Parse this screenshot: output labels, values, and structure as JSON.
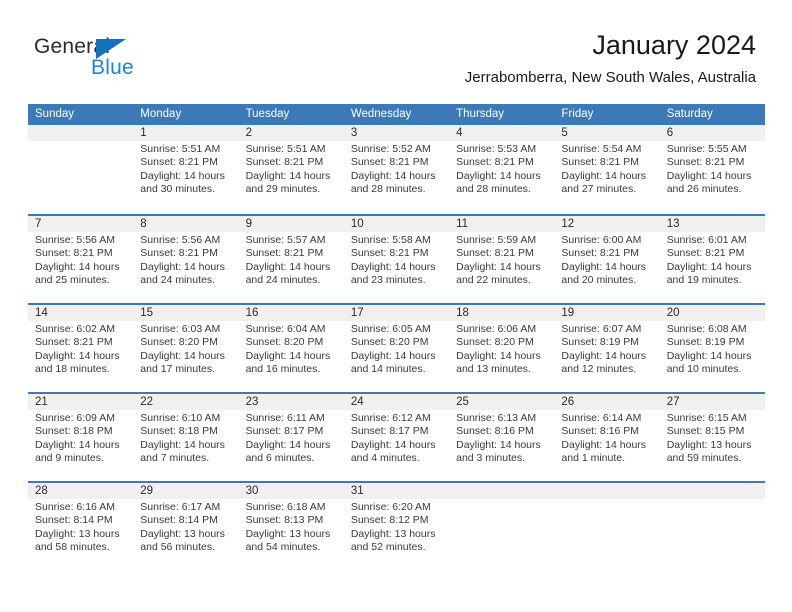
{
  "brand": {
    "name_part1": "General",
    "name_part2": "Blue",
    "color_dark": "#2b2b2b",
    "color_blue": "#1e84d6",
    "triangle_color": "#1271c0"
  },
  "header": {
    "title": "January 2024",
    "subtitle": "Jerrabomberra, New South Wales, Australia"
  },
  "theme": {
    "header_blue": "#3b79b8",
    "number_band_gray": "#f0f0f0",
    "text_color": "#3a3a3a"
  },
  "weekday_headers": [
    "Sunday",
    "Monday",
    "Tuesday",
    "Wednesday",
    "Thursday",
    "Friday",
    "Saturday"
  ],
  "weeks": [
    {
      "days": [
        {
          "number": "",
          "sunrise": "",
          "sunset": "",
          "daylight_line1": "",
          "daylight_line2": ""
        },
        {
          "number": "1",
          "sunrise": "Sunrise: 5:51 AM",
          "sunset": "Sunset: 8:21 PM",
          "daylight_line1": "Daylight: 14 hours",
          "daylight_line2": "and 30 minutes."
        },
        {
          "number": "2",
          "sunrise": "Sunrise: 5:51 AM",
          "sunset": "Sunset: 8:21 PM",
          "daylight_line1": "Daylight: 14 hours",
          "daylight_line2": "and 29 minutes."
        },
        {
          "number": "3",
          "sunrise": "Sunrise: 5:52 AM",
          "sunset": "Sunset: 8:21 PM",
          "daylight_line1": "Daylight: 14 hours",
          "daylight_line2": "and 28 minutes."
        },
        {
          "number": "4",
          "sunrise": "Sunrise: 5:53 AM",
          "sunset": "Sunset: 8:21 PM",
          "daylight_line1": "Daylight: 14 hours",
          "daylight_line2": "and 28 minutes."
        },
        {
          "number": "5",
          "sunrise": "Sunrise: 5:54 AM",
          "sunset": "Sunset: 8:21 PM",
          "daylight_line1": "Daylight: 14 hours",
          "daylight_line2": "and 27 minutes."
        },
        {
          "number": "6",
          "sunrise": "Sunrise: 5:55 AM",
          "sunset": "Sunset: 8:21 PM",
          "daylight_line1": "Daylight: 14 hours",
          "daylight_line2": "and 26 minutes."
        }
      ]
    },
    {
      "days": [
        {
          "number": "7",
          "sunrise": "Sunrise: 5:56 AM",
          "sunset": "Sunset: 8:21 PM",
          "daylight_line1": "Daylight: 14 hours",
          "daylight_line2": "and 25 minutes."
        },
        {
          "number": "8",
          "sunrise": "Sunrise: 5:56 AM",
          "sunset": "Sunset: 8:21 PM",
          "daylight_line1": "Daylight: 14 hours",
          "daylight_line2": "and 24 minutes."
        },
        {
          "number": "9",
          "sunrise": "Sunrise: 5:57 AM",
          "sunset": "Sunset: 8:21 PM",
          "daylight_line1": "Daylight: 14 hours",
          "daylight_line2": "and 24 minutes."
        },
        {
          "number": "10",
          "sunrise": "Sunrise: 5:58 AM",
          "sunset": "Sunset: 8:21 PM",
          "daylight_line1": "Daylight: 14 hours",
          "daylight_line2": "and 23 minutes."
        },
        {
          "number": "11",
          "sunrise": "Sunrise: 5:59 AM",
          "sunset": "Sunset: 8:21 PM",
          "daylight_line1": "Daylight: 14 hours",
          "daylight_line2": "and 22 minutes."
        },
        {
          "number": "12",
          "sunrise": "Sunrise: 6:00 AM",
          "sunset": "Sunset: 8:21 PM",
          "daylight_line1": "Daylight: 14 hours",
          "daylight_line2": "and 20 minutes."
        },
        {
          "number": "13",
          "sunrise": "Sunrise: 6:01 AM",
          "sunset": "Sunset: 8:21 PM",
          "daylight_line1": "Daylight: 14 hours",
          "daylight_line2": "and 19 minutes."
        }
      ]
    },
    {
      "days": [
        {
          "number": "14",
          "sunrise": "Sunrise: 6:02 AM",
          "sunset": "Sunset: 8:21 PM",
          "daylight_line1": "Daylight: 14 hours",
          "daylight_line2": "and 18 minutes."
        },
        {
          "number": "15",
          "sunrise": "Sunrise: 6:03 AM",
          "sunset": "Sunset: 8:20 PM",
          "daylight_line1": "Daylight: 14 hours",
          "daylight_line2": "and 17 minutes."
        },
        {
          "number": "16",
          "sunrise": "Sunrise: 6:04 AM",
          "sunset": "Sunset: 8:20 PM",
          "daylight_line1": "Daylight: 14 hours",
          "daylight_line2": "and 16 minutes."
        },
        {
          "number": "17",
          "sunrise": "Sunrise: 6:05 AM",
          "sunset": "Sunset: 8:20 PM",
          "daylight_line1": "Daylight: 14 hours",
          "daylight_line2": "and 14 minutes."
        },
        {
          "number": "18",
          "sunrise": "Sunrise: 6:06 AM",
          "sunset": "Sunset: 8:20 PM",
          "daylight_line1": "Daylight: 14 hours",
          "daylight_line2": "and 13 minutes."
        },
        {
          "number": "19",
          "sunrise": "Sunrise: 6:07 AM",
          "sunset": "Sunset: 8:19 PM",
          "daylight_line1": "Daylight: 14 hours",
          "daylight_line2": "and 12 minutes."
        },
        {
          "number": "20",
          "sunrise": "Sunrise: 6:08 AM",
          "sunset": "Sunset: 8:19 PM",
          "daylight_line1": "Daylight: 14 hours",
          "daylight_line2": "and 10 minutes."
        }
      ]
    },
    {
      "days": [
        {
          "number": "21",
          "sunrise": "Sunrise: 6:09 AM",
          "sunset": "Sunset: 8:18 PM",
          "daylight_line1": "Daylight: 14 hours",
          "daylight_line2": "and 9 minutes."
        },
        {
          "number": "22",
          "sunrise": "Sunrise: 6:10 AM",
          "sunset": "Sunset: 8:18 PM",
          "daylight_line1": "Daylight: 14 hours",
          "daylight_line2": "and 7 minutes."
        },
        {
          "number": "23",
          "sunrise": "Sunrise: 6:11 AM",
          "sunset": "Sunset: 8:17 PM",
          "daylight_line1": "Daylight: 14 hours",
          "daylight_line2": "and 6 minutes."
        },
        {
          "number": "24",
          "sunrise": "Sunrise: 6:12 AM",
          "sunset": "Sunset: 8:17 PM",
          "daylight_line1": "Daylight: 14 hours",
          "daylight_line2": "and 4 minutes."
        },
        {
          "number": "25",
          "sunrise": "Sunrise: 6:13 AM",
          "sunset": "Sunset: 8:16 PM",
          "daylight_line1": "Daylight: 14 hours",
          "daylight_line2": "and 3 minutes."
        },
        {
          "number": "26",
          "sunrise": "Sunrise: 6:14 AM",
          "sunset": "Sunset: 8:16 PM",
          "daylight_line1": "Daylight: 14 hours",
          "daylight_line2": "and 1 minute."
        },
        {
          "number": "27",
          "sunrise": "Sunrise: 6:15 AM",
          "sunset": "Sunset: 8:15 PM",
          "daylight_line1": "Daylight: 13 hours",
          "daylight_line2": "and 59 minutes."
        }
      ]
    },
    {
      "days": [
        {
          "number": "28",
          "sunrise": "Sunrise: 6:16 AM",
          "sunset": "Sunset: 8:14 PM",
          "daylight_line1": "Daylight: 13 hours",
          "daylight_line2": "and 58 minutes."
        },
        {
          "number": "29",
          "sunrise": "Sunrise: 6:17 AM",
          "sunset": "Sunset: 8:14 PM",
          "daylight_line1": "Daylight: 13 hours",
          "daylight_line2": "and 56 minutes."
        },
        {
          "number": "30",
          "sunrise": "Sunrise: 6:18 AM",
          "sunset": "Sunset: 8:13 PM",
          "daylight_line1": "Daylight: 13 hours",
          "daylight_line2": "and 54 minutes."
        },
        {
          "number": "31",
          "sunrise": "Sunrise: 6:20 AM",
          "sunset": "Sunset: 8:12 PM",
          "daylight_line1": "Daylight: 13 hours",
          "daylight_line2": "and 52 minutes."
        },
        {
          "number": "",
          "sunrise": "",
          "sunset": "",
          "daylight_line1": "",
          "daylight_line2": ""
        },
        {
          "number": "",
          "sunrise": "",
          "sunset": "",
          "daylight_line1": "",
          "daylight_line2": ""
        },
        {
          "number": "",
          "sunrise": "",
          "sunset": "",
          "daylight_line1": "",
          "daylight_line2": ""
        }
      ]
    }
  ]
}
